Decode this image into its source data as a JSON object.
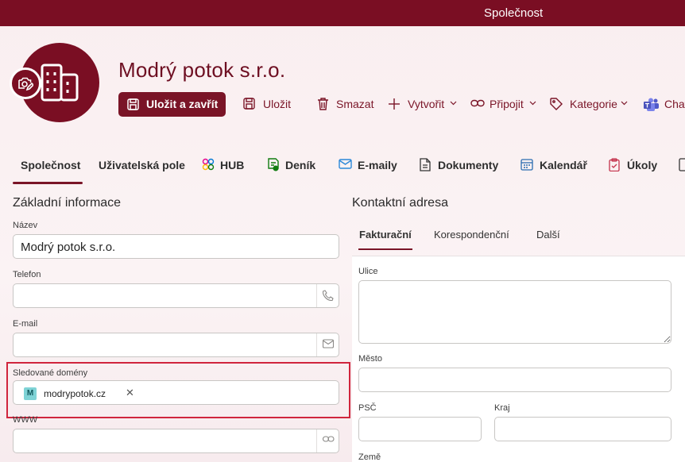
{
  "window": {
    "title": "Společnost"
  },
  "company": {
    "name": "Modrý potok s.r.o."
  },
  "toolbar": {
    "save_close": "Uložit a zavřít",
    "save": "Uložit",
    "delete": "Smazat",
    "create": "Vytvořit",
    "attach": "Připojit",
    "category": "Kategorie",
    "chat": "Chat"
  },
  "tabs": [
    {
      "label": "Společnost",
      "icon": "none"
    },
    {
      "label": "Uživatelská pole",
      "icon": "none"
    },
    {
      "label": "HUB",
      "icon": "hub-icon"
    },
    {
      "label": "Deník",
      "icon": "journal-icon"
    },
    {
      "label": "E-maily",
      "icon": "mail-icon"
    },
    {
      "label": "Dokumenty",
      "icon": "document-icon"
    },
    {
      "label": "Kalendář",
      "icon": "calendar-icon"
    },
    {
      "label": "Úkoly",
      "icon": "clipboard-icon"
    }
  ],
  "basic": {
    "title": "Základní informace",
    "name_label": "Název",
    "name_value": "Modrý potok s.r.o.",
    "phone_label": "Telefon",
    "phone_value": "",
    "email_label": "E-mail",
    "email_value": "",
    "domains_label": "Sledované domény",
    "domain_chip_initial": "M",
    "domain_chip": "modrypotok.cz",
    "www_label": "WWW",
    "www_value": ""
  },
  "contact": {
    "title": "Kontaktní adresa",
    "subtabs": [
      "Fakturační",
      "Korespondenční",
      "Další"
    ],
    "street_label": "Ulice",
    "city_label": "Město",
    "zip_label": "PSČ",
    "region_label": "Kraj",
    "country_label": "Země"
  },
  "colors": {
    "accent": "#7a0e23",
    "highlight": "#d0253d"
  }
}
